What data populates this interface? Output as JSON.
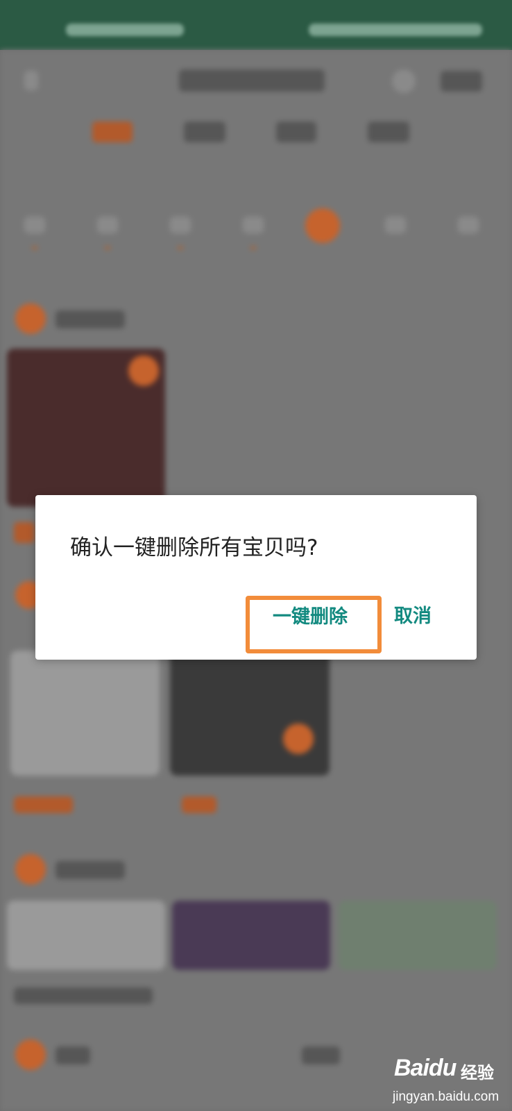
{
  "dialog": {
    "message": "确认一键删除所有宝贝吗?",
    "confirm_label": "一键删除",
    "cancel_label": "取消"
  },
  "watermark": {
    "logo": "Baidu",
    "brand": "经验",
    "url": "jingyan.baidu.com"
  },
  "colors": {
    "dialog_button": "#138a80",
    "highlight_box": "#f28c3a",
    "status_bar": "#2b5a44"
  }
}
